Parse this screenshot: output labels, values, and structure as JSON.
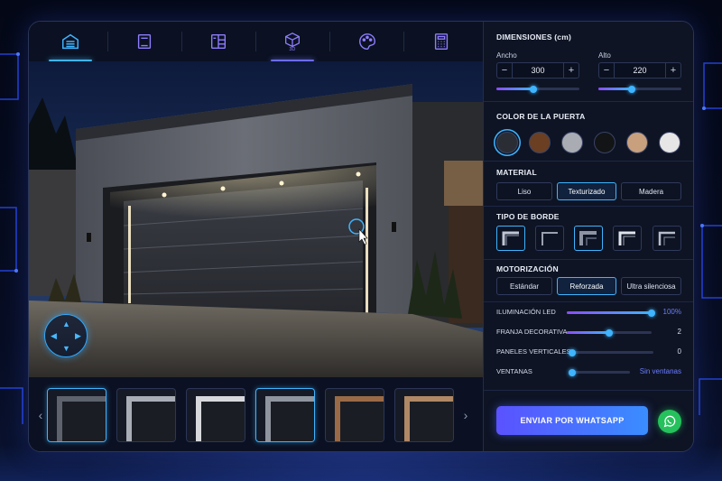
{
  "colors": {
    "accent": "#3fb4ff",
    "accent2": "#6b6bff",
    "whatsapp": "#25c15c",
    "panel": "#0e1424"
  },
  "topnav": {
    "items": [
      {
        "icon": "garage-icon",
        "active": true
      },
      {
        "icon": "door-panel-icon",
        "active": false
      },
      {
        "icon": "layout-icon",
        "active": false
      },
      {
        "icon": "cube-3d-icon",
        "label": "3D",
        "active": true
      },
      {
        "icon": "palette-icon",
        "active": false
      },
      {
        "icon": "calculator-icon",
        "active": false
      }
    ]
  },
  "dimensions": {
    "title": "DIMENSIONES (cm)",
    "width_label": "Ancho",
    "width_value": "300",
    "width_level": 0.45,
    "height_label": "Alto",
    "height_value": "220",
    "height_level": 0.4,
    "minus": "−",
    "plus": "+"
  },
  "color": {
    "title": "COLOR DE LA PUERTA",
    "swatches": [
      "#2a2d33",
      "#6b3f22",
      "#a9acb2",
      "#131416",
      "#c8a07e",
      "#e6e6e6"
    ],
    "selected": 0
  },
  "material": {
    "title": "MATERIAL",
    "options": [
      "Liso",
      "Texturizado",
      "Madera"
    ],
    "selected": 1
  },
  "border": {
    "title": "TIPO DE BORDE",
    "count": 5,
    "selected": 0
  },
  "motor": {
    "title": "MOTORIZACIÓN",
    "options": [
      "Estándar",
      "Reforzada",
      "Ultra silenciosa"
    ],
    "selected": 1
  },
  "sliders": [
    {
      "label": "ILUMINACIÓN LED",
      "value": "100%",
      "level": 1.0,
      "accent": true
    },
    {
      "label": "FRANJA DECORATIVA",
      "value": "2",
      "level": 0.5,
      "accent": false
    },
    {
      "label": "PANELES VERTICALES",
      "value": "0",
      "level": 0.0,
      "accent": false
    },
    {
      "label": "VENTANAS",
      "value": "Sin ventanas",
      "level": 0.0,
      "accent": true
    }
  ],
  "cta": {
    "label": "ENVIAR POR WHATSAPP"
  },
  "thumbs": {
    "count": 6,
    "selected": 0,
    "prev": "‹",
    "next": "›"
  },
  "joystick": {
    "up": "▲",
    "down": "▼",
    "left": "◀",
    "right": "▶"
  }
}
